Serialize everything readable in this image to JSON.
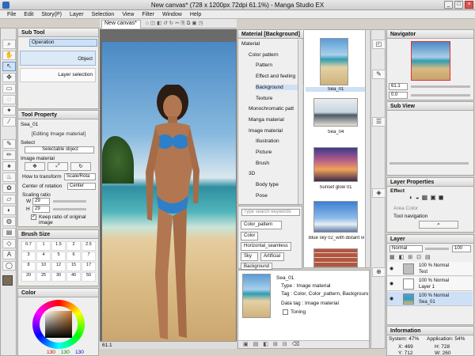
{
  "window": {
    "title": "New canvas* (728 x 1200px 72dpi 61.1%) - Manga Studio EX"
  },
  "menu": [
    "File",
    "Edit",
    "Story(P)",
    "Layer",
    "Selection",
    "View",
    "Filter",
    "Window",
    "Help"
  ],
  "subtool": {
    "title": "Sub Tool",
    "operation": "Operation",
    "items": [
      "Object",
      "Layer selection"
    ]
  },
  "toolprop": {
    "title": "Tool Property",
    "name": "Sea_01",
    "editing": "[Editing Image material]",
    "select_label": "Select",
    "select_value": "Selectable object",
    "image_material": "Image material",
    "how_to_transform": "How to transform",
    "transform_value": "Scale/Rota",
    "center_label": "Center of rotation",
    "center_value": "Center",
    "scaling": "Scaling ratio",
    "w_label": "W",
    "w_value": "29",
    "h_label": "H",
    "h_value": "29",
    "keep_ratio": "Keep ratio of original image"
  },
  "brushsize": {
    "title": "Brush Size",
    "sizes": [
      "0.7",
      "1",
      "1.5",
      "2",
      "2.5",
      "3",
      "4",
      "5",
      "6",
      "7",
      "8",
      "10",
      "12",
      "15",
      "17",
      "20",
      "25",
      "30",
      "40",
      "50"
    ]
  },
  "color": {
    "title": "Color",
    "r": "130",
    "g": "130",
    "b": "130",
    "main": "#7a6a58"
  },
  "canvas": {
    "tab": "New canvas*",
    "zoom": "61.1"
  },
  "material": {
    "title": "Material [Background]",
    "tree": [
      {
        "label": "Material",
        "level": 0
      },
      {
        "label": "Color pattern",
        "level": 1
      },
      {
        "label": "Pattern",
        "level": 2
      },
      {
        "label": "Effect and feeling",
        "level": 2
      },
      {
        "label": "Background",
        "level": 2,
        "sel": true
      },
      {
        "label": "Texture",
        "level": 2
      },
      {
        "label": "Monochromatic patt",
        "level": 1
      },
      {
        "label": "Manga material",
        "level": 1
      },
      {
        "label": "Image material",
        "level": 1
      },
      {
        "label": "Illustration",
        "level": 2
      },
      {
        "label": "Picture",
        "level": 2
      },
      {
        "label": "Brush",
        "level": 2
      },
      {
        "label": "3D",
        "level": 1
      },
      {
        "label": "Body type",
        "level": 2
      },
      {
        "label": "Pose",
        "level": 2
      }
    ],
    "search_placeholder": "Type search keywords",
    "tags": [
      "Color_pattern",
      "Color",
      "Horizontal_seamless",
      "Sky",
      "Artificial",
      "Background"
    ],
    "thumbs": [
      "Sea_01",
      "Sea_04",
      "Sunset glow 01",
      "Blue sky 02_with distant vi",
      ""
    ],
    "detail": {
      "name": "Sea_01",
      "type": "Type : Image material",
      "tag": "Tag : Color, Color_pattern, Background, W",
      "datatag": "Data tag : Image material",
      "toning": "Toning"
    }
  },
  "navigator": {
    "title": "Navigator",
    "zoom": "61.1",
    "angle": "0.0"
  },
  "subview": {
    "title": "Sub View"
  },
  "layerprop": {
    "title": "Layer Properties",
    "effect": "Effect",
    "area_color": "Area Color",
    "tool_nav": "Tool navigation"
  },
  "layer": {
    "title": "Layer",
    "mode": "Normal",
    "opacity": "100",
    "rows": [
      {
        "top": "100 %",
        "mode": "Normal",
        "name": "Test"
      },
      {
        "top": "100 %",
        "mode": "Normal",
        "name": "Layer 1"
      },
      {
        "top": "100 %",
        "mode": "Normal",
        "name": "Sea_01"
      }
    ]
  },
  "info": {
    "title": "Information",
    "system": "System: 47%",
    "application": "Application: 54%",
    "x": "X: 469",
    "y": "Y: 712",
    "w": "W: 260",
    "h": "H: 728"
  }
}
